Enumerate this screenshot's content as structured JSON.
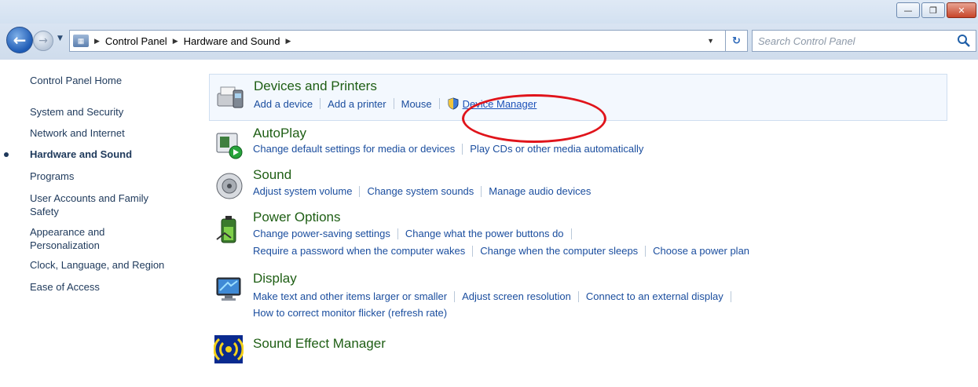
{
  "window": {
    "minimize_label": "—",
    "restore_label": "❐",
    "close_label": "✕"
  },
  "address_bar": {
    "breadcrumbs": [
      "Control Panel",
      "Hardware and Sound"
    ],
    "search_placeholder": "Search Control Panel"
  },
  "sidebar": {
    "items": [
      {
        "label": "Control Panel Home"
      },
      {
        "label": "System and Security"
      },
      {
        "label": "Network and Internet"
      },
      {
        "label": "Hardware and Sound",
        "current": true
      },
      {
        "label": "Programs"
      },
      {
        "label": "User Accounts and Family Safety"
      },
      {
        "label": "Appearance and Personalization"
      },
      {
        "label": "Clock, Language, and Region"
      },
      {
        "label": "Ease of Access"
      }
    ]
  },
  "categories": [
    {
      "title": "Devices and Printers",
      "icon": "printer-icon",
      "links": [
        "Add a device",
        "Add a printer",
        "Mouse",
        "Device Manager"
      ]
    },
    {
      "title": "AutoPlay",
      "icon": "autoplay-icon",
      "links": [
        "Change default settings for media or devices",
        "Play CDs or other media automatically"
      ]
    },
    {
      "title": "Sound",
      "icon": "speaker-icon",
      "links": [
        "Adjust system volume",
        "Change system sounds",
        "Manage audio devices"
      ]
    },
    {
      "title": "Power Options",
      "icon": "battery-icon",
      "links": [
        "Change power-saving settings",
        "Change what the power buttons do",
        "Require a password when the computer wakes",
        "Change when the computer sleeps",
        "Choose a power plan"
      ]
    },
    {
      "title": "Display",
      "icon": "monitor-icon",
      "links": [
        "Make text and other items larger or smaller",
        "Adjust screen resolution",
        "Connect to an external display",
        "How to correct monitor flicker (refresh rate)"
      ]
    },
    {
      "title": "Sound Effect Manager",
      "icon": "sound-effect-icon",
      "links": []
    }
  ],
  "colors": {
    "category_title": "#1e5e14",
    "link": "#1a4d9e",
    "annotation": "#e0141b"
  }
}
